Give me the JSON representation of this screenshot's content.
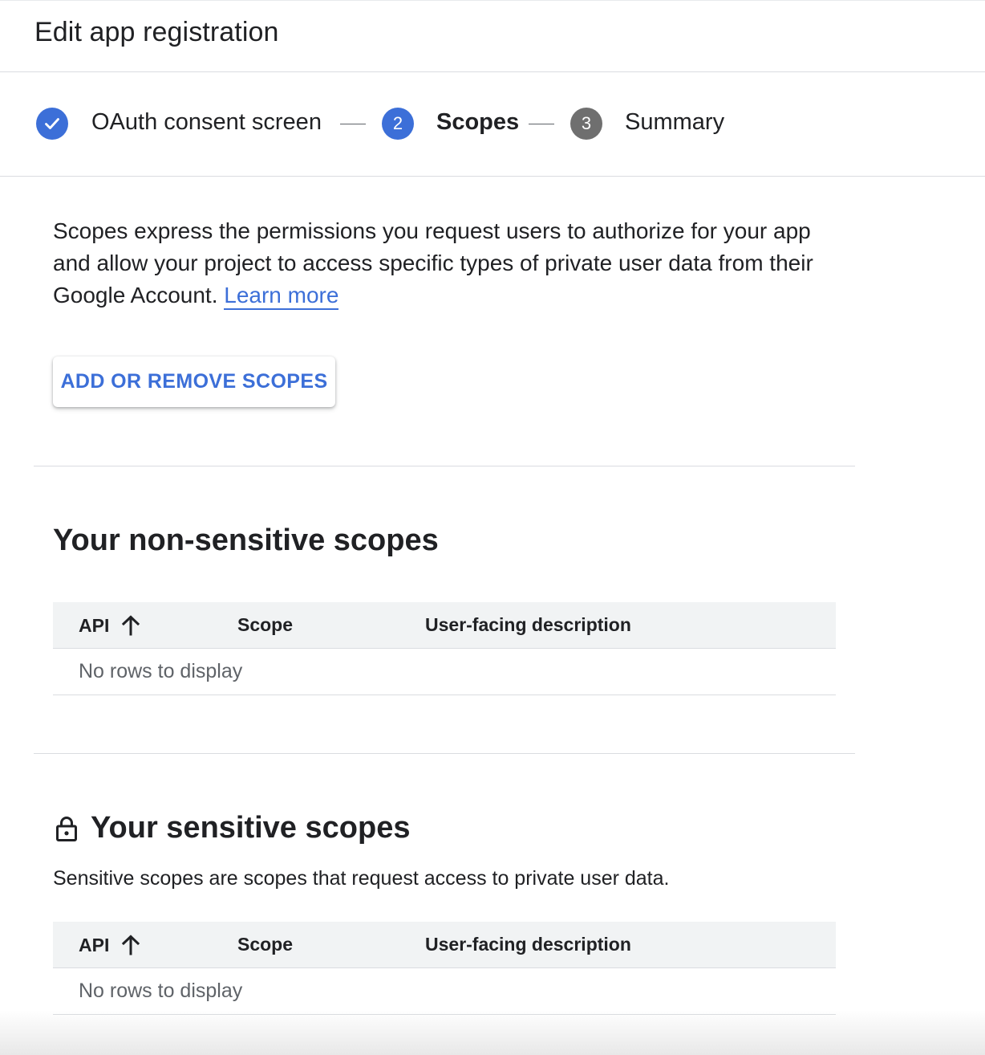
{
  "header": {
    "title": "Edit app registration"
  },
  "stepper": {
    "steps": [
      {
        "number": "1",
        "label": "OAuth consent screen",
        "state": "completed",
        "icon": "check-icon"
      },
      {
        "number": "2",
        "label": "Scopes",
        "state": "active"
      },
      {
        "number": "3",
        "label": "Summary",
        "state": "pending"
      }
    ]
  },
  "intro": {
    "text": "Scopes express the permissions you request users to authorize for your app and allow your project to access specific types of private user data from their Google Account. ",
    "link_label": "Learn more"
  },
  "actions": {
    "add_remove_label": "ADD OR REMOVE SCOPES"
  },
  "non_sensitive": {
    "title": "Your non-sensitive scopes",
    "table": {
      "columns": [
        "API",
        "Scope",
        "User-facing description"
      ],
      "sort_column": "API",
      "sort_direction": "ascending",
      "empty_text": "No rows to display"
    }
  },
  "sensitive": {
    "title": "Your sensitive scopes",
    "icon": "lock-icon",
    "description": "Sensitive scopes are scopes that request access to private user data.",
    "table": {
      "columns": [
        "API",
        "Scope",
        "User-facing description"
      ],
      "sort_column": "API",
      "sort_direction": "ascending",
      "empty_text": "No rows to display"
    }
  },
  "colors": {
    "accent": "#3c6fd8",
    "pending_step": "#6f6f6f",
    "text": "#202124",
    "muted_text": "#5f6368",
    "table_header_bg": "#f1f3f4",
    "divider": "#dadce0"
  }
}
